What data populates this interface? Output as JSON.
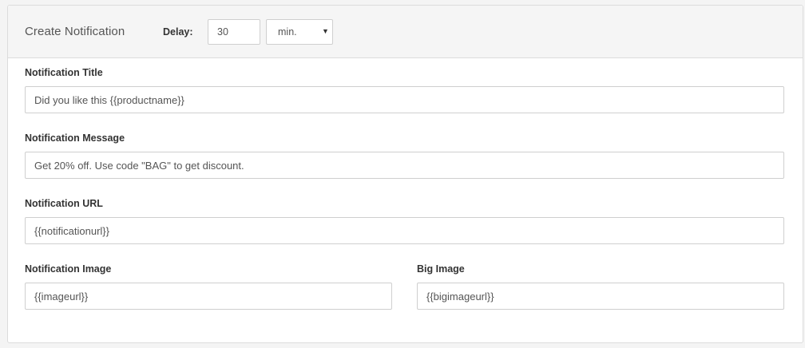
{
  "header": {
    "title": "Create Notification",
    "delay_label": "Delay:",
    "delay_value": "30",
    "unit_value": "min.",
    "caret": "▼"
  },
  "fields": {
    "title": {
      "label": "Notification Title",
      "value": "Did you like this {{productname}}"
    },
    "message": {
      "label": "Notification Message",
      "value": "Get 20% off. Use code \"BAG\" to get discount."
    },
    "url": {
      "label": "Notification URL",
      "value": "{{notificationurl}}"
    },
    "image": {
      "label": "Notification Image",
      "value": "{{imageurl}}"
    },
    "big_image": {
      "label": "Big Image",
      "value": "{{bigimageurl}}"
    }
  }
}
